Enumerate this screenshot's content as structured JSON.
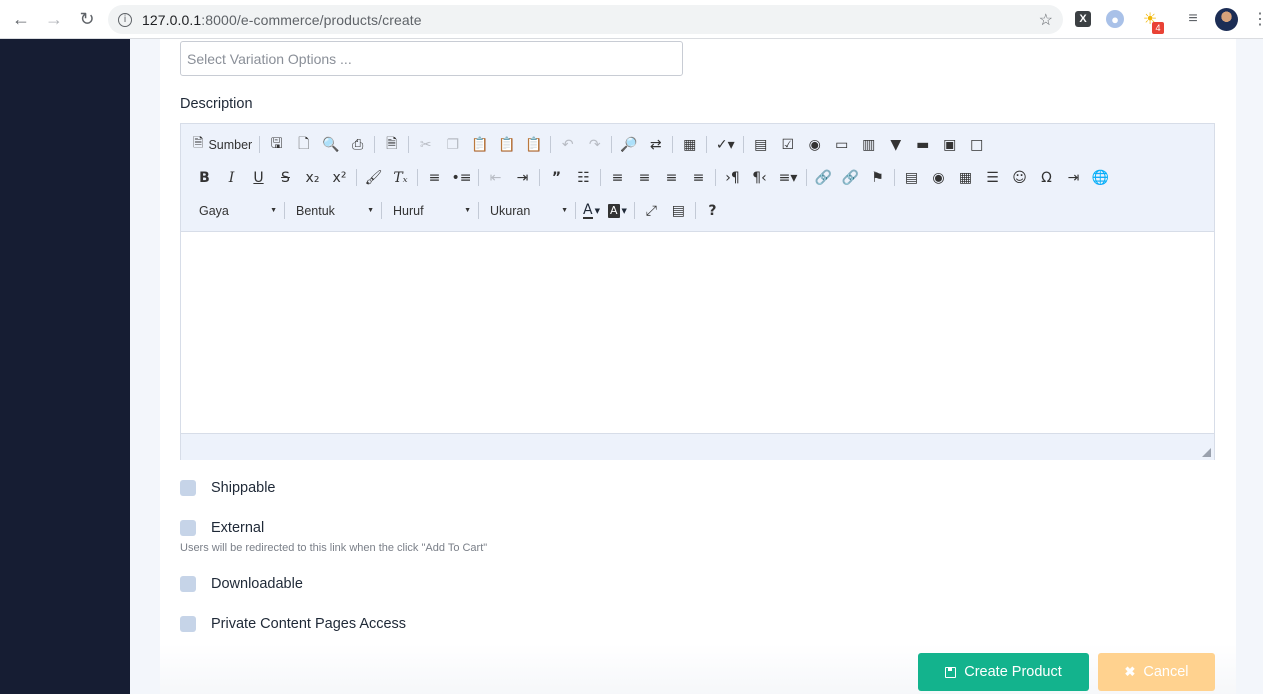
{
  "browser": {
    "url_host": "127.0.0.1",
    "url_path": ":8000/e-commerce/products/create",
    "ext_badge": "4"
  },
  "form": {
    "variation_placeholder": "Select Variation Options ...",
    "description_label": "Description"
  },
  "editor": {
    "source_label": "Sumber",
    "style_combo": "Gaya",
    "format_combo": "Bentuk",
    "font_combo": "Huruf",
    "size_combo": "Ukuran",
    "text_color_glyph": "A",
    "bg_color_glyph": "A",
    "help_glyph": "?"
  },
  "options": [
    {
      "label": "Shippable"
    },
    {
      "label": "External",
      "hint": "Users will be redirected to this link when the click \"Add To Cart\""
    },
    {
      "label": "Downloadable"
    },
    {
      "label": "Private Content Pages Access"
    }
  ],
  "actions": {
    "create_label": "Create Product",
    "cancel_label": "Cancel"
  },
  "colors": {
    "sidebar": "#161d33",
    "primary": "#13b38d",
    "warning": "#ffd28f",
    "checkbox": "#c6d4e8"
  }
}
